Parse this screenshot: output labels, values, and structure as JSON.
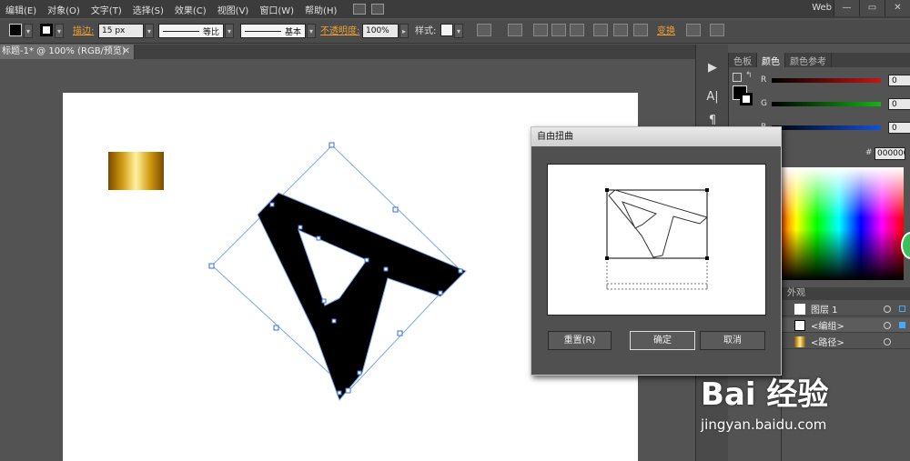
{
  "menubar": {
    "items": [
      "编辑(E)",
      "对象(O)",
      "文字(T)",
      "选择(S)",
      "效果(C)",
      "视图(V)",
      "窗口(W)",
      "帮助(H)"
    ],
    "workspace": "Web",
    "win_buttons": [
      "—",
      "▭",
      "✕"
    ]
  },
  "controlbar": {
    "stroke_label": "描边:",
    "stroke_weight": "15 px",
    "profile_label": "等比",
    "brush_label": "基本",
    "opacity_label": "不透明度:",
    "opacity_value": "100%",
    "style_label": "样式:",
    "transform_label": "变换"
  },
  "document": {
    "tab_title": "标题-1* @ 100% (RGB/预览)",
    "tab_close": "✕"
  },
  "color_panel": {
    "tabs": [
      "色板",
      "颜色",
      "颜色参考"
    ],
    "active_tab": "颜色",
    "sliders": [
      {
        "name": "R",
        "value": "0",
        "color": "#c81414"
      },
      {
        "name": "G",
        "value": "0",
        "color": "#14b414"
      },
      {
        "name": "B",
        "value": "0",
        "color": "#1450dc"
      }
    ],
    "hex_prefix": "#",
    "hex_value": "000000"
  },
  "layers_panel": {
    "tab": "外观",
    "rows": [
      {
        "label": "图层 1"
      },
      {
        "label": "<编组>"
      },
      {
        "label": "<路径>"
      }
    ]
  },
  "dialog": {
    "title": "自由扭曲",
    "reset_button": "重置(R)",
    "ok_button": "确定",
    "cancel_button": "取消"
  },
  "watermark": {
    "brand": "Bai 经验",
    "url": "jingyan.baidu.com"
  }
}
